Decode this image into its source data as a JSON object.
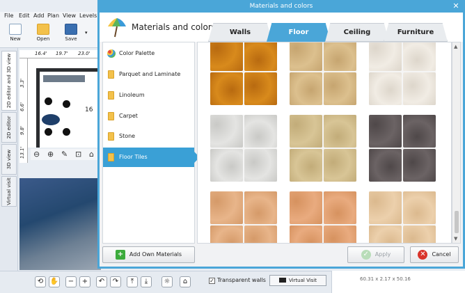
{
  "background_app": {
    "menu": [
      "File",
      "Edit",
      "Add",
      "Plan",
      "View",
      "Levels"
    ],
    "toolbar": [
      {
        "label": "New",
        "icon": "new-file-icon"
      },
      {
        "label": "Open",
        "icon": "folder-open-icon"
      },
      {
        "label": "Save",
        "icon": "save-icon"
      }
    ],
    "vertical_tabs": [
      "2D editor and 3D view",
      "2D editor",
      "3D view",
      "Virtual visit"
    ],
    "ruler_top": [
      "16.4'",
      "19.7'",
      "23.0'"
    ],
    "ruler_left": [
      "3.3'",
      "6.6'",
      "9.8'",
      "13.1'"
    ],
    "plan_label": "16",
    "transparent_walls_label": "Transparent walls",
    "transparent_walls_checked": true,
    "virtual_visit_label": "Virtual Visit",
    "info_dims": "60.31 x 2.17 x 50.16"
  },
  "dialog": {
    "title": "Materials and colors",
    "heading": "Materials and colors",
    "close_glyph": "✕",
    "tabs": [
      {
        "label": "Walls",
        "active": false
      },
      {
        "label": "Floor",
        "active": true
      },
      {
        "label": "Ceiling",
        "active": false
      },
      {
        "label": "Furniture",
        "active": false
      }
    ],
    "categories": [
      {
        "label": "Color Palette",
        "icon": "color-palette-icon",
        "active": false
      },
      {
        "label": "Parquet and Laminate",
        "icon": "folder-icon",
        "active": false
      },
      {
        "label": "Linoleum",
        "icon": "folder-icon",
        "active": false
      },
      {
        "label": "Carpet",
        "icon": "folder-icon",
        "active": false
      },
      {
        "label": "Stone",
        "icon": "folder-icon",
        "active": false
      },
      {
        "label": "Floor Tiles",
        "icon": "folder-icon",
        "active": true
      }
    ],
    "swatches": [
      {
        "color": "#d88a1c",
        "edge": "#b86a10"
      },
      {
        "color": "#dcc08e",
        "edge": "#c6a570"
      },
      {
        "color": "#f1ece4",
        "edge": "#ddd6cb"
      },
      {
        "color": "#e4e4e2",
        "edge": "#c9c9c6"
      },
      {
        "color": "#d8c596",
        "edge": "#c2ac79"
      },
      {
        "color": "#6b6364",
        "edge": "#4f4849"
      },
      {
        "color": "#e8b58a",
        "edge": "#d59a69"
      },
      {
        "color": "#e9ab7f",
        "edge": "#d6925f"
      },
      {
        "color": "#ecd0ac",
        "edge": "#dbb98e"
      }
    ],
    "add_button_label": "Add Own Materials",
    "apply_button_label": "Apply",
    "apply_enabled": false,
    "cancel_button_label": "Cancel"
  }
}
